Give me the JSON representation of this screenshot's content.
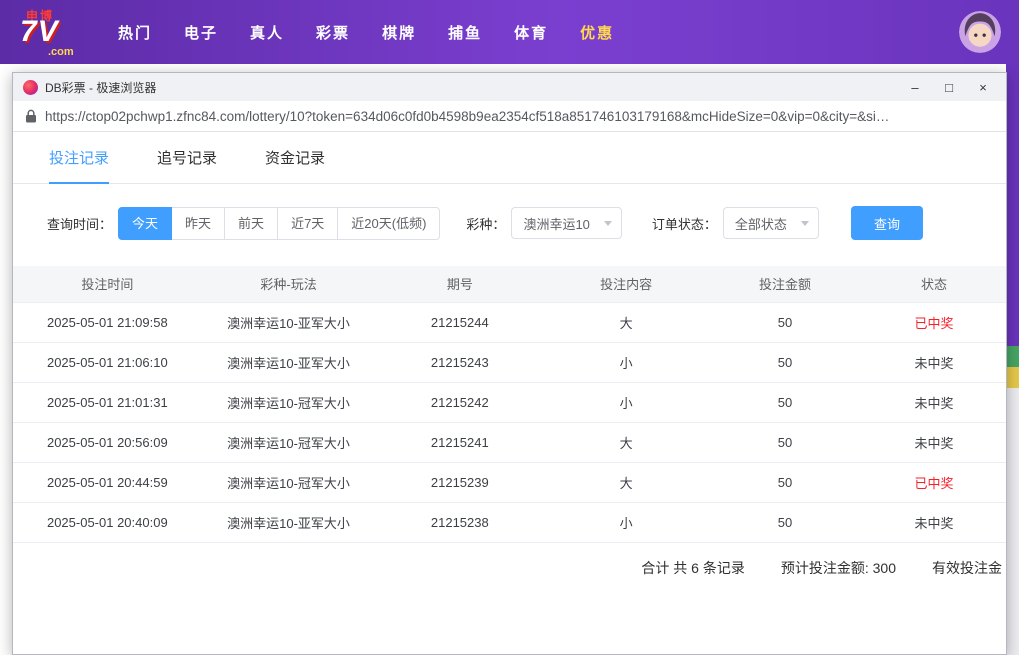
{
  "top_nav": {
    "logo": {
      "top": "申博",
      "main": "7V",
      "bottom": ".com"
    },
    "items": [
      {
        "label": "热门",
        "active": false
      },
      {
        "label": "电子",
        "active": false
      },
      {
        "label": "真人",
        "active": false
      },
      {
        "label": "彩票",
        "active": false
      },
      {
        "label": "棋牌",
        "active": false
      },
      {
        "label": "捕鱼",
        "active": false
      },
      {
        "label": "体育",
        "active": false
      },
      {
        "label": "优惠",
        "active": true
      }
    ]
  },
  "browser": {
    "window_title": "DB彩票 - 极速浏览器",
    "url": "https://ctop02pchwp1.zfnc84.com/lottery/10?token=634d06c0fd0b4598b9ea2354cf518a851746103179168&mcHideSize=0&vip=0&city=&si…",
    "controls": {
      "minimize": "–",
      "maximize": "□",
      "close": "×"
    }
  },
  "tabs": [
    {
      "label": "投注记录",
      "active": true
    },
    {
      "label": "追号记录",
      "active": false
    },
    {
      "label": "资金记录",
      "active": false
    }
  ],
  "filters": {
    "time_label": "查询时间：",
    "time_options": [
      {
        "label": "今天",
        "active": true
      },
      {
        "label": "昨天",
        "active": false
      },
      {
        "label": "前天",
        "active": false
      },
      {
        "label": "近7天",
        "active": false
      },
      {
        "label": "近20天(低频)",
        "active": false
      }
    ],
    "lottery_label": "彩种：",
    "lottery_value": "澳洲幸运10",
    "status_label": "订单状态：",
    "status_value": "全部状态",
    "query_label": "查询"
  },
  "table": {
    "headers": [
      "投注时间",
      "彩种-玩法",
      "期号",
      "投注内容",
      "投注金额",
      "状态"
    ],
    "rows": [
      {
        "time": "2025-05-01 21:09:58",
        "game": "澳洲幸运10-亚军大小",
        "issue": "21215244",
        "content": "大",
        "amount": "50",
        "status": "已中奖",
        "won": true
      },
      {
        "time": "2025-05-01 21:06:10",
        "game": "澳洲幸运10-亚军大小",
        "issue": "21215243",
        "content": "小",
        "amount": "50",
        "status": "未中奖",
        "won": false
      },
      {
        "time": "2025-05-01 21:01:31",
        "game": "澳洲幸运10-冠军大小",
        "issue": "21215242",
        "content": "小",
        "amount": "50",
        "status": "未中奖",
        "won": false
      },
      {
        "time": "2025-05-01 20:56:09",
        "game": "澳洲幸运10-冠军大小",
        "issue": "21215241",
        "content": "大",
        "amount": "50",
        "status": "未中奖",
        "won": false
      },
      {
        "time": "2025-05-01 20:44:59",
        "game": "澳洲幸运10-冠军大小",
        "issue": "21215239",
        "content": "大",
        "amount": "50",
        "status": "已中奖",
        "won": true
      },
      {
        "time": "2025-05-01 20:40:09",
        "game": "澳洲幸运10-亚军大小",
        "issue": "21215238",
        "content": "小",
        "amount": "50",
        "status": "未中奖",
        "won": false
      }
    ]
  },
  "summary": {
    "total": "合计 共 6 条记录",
    "expected": "预计投注金额: 300",
    "valid": "有效投注金"
  },
  "colors": {
    "accent_blue": "#409eff",
    "header_purple": "#6a34bd",
    "nav_active_yellow": "#ffd84d",
    "win_red": "#f5222d"
  }
}
